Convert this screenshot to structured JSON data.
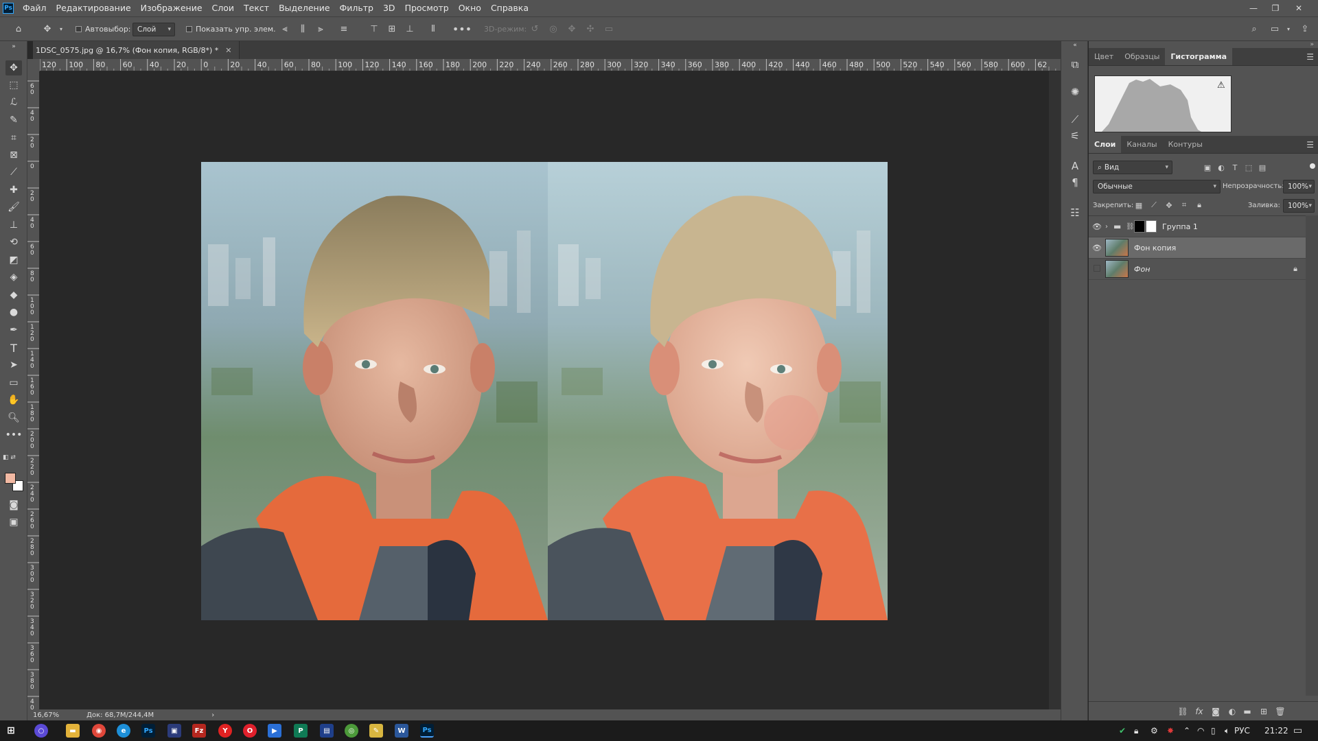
{
  "app": {
    "logo": "Ps"
  },
  "menu": [
    "Файл",
    "Редактирование",
    "Изображение",
    "Слои",
    "Текст",
    "Выделение",
    "Фильтр",
    "3D",
    "Просмотр",
    "Окно",
    "Справка"
  ],
  "options": {
    "auto_select_label": "Автовыбор:",
    "auto_select_value": "Слой",
    "show_transform_label": "Показать упр. элем.",
    "mode_3d_label": "3D-режим:"
  },
  "document": {
    "tab_title": "1DSC_0575.jpg @ 16,7% (Фон копия, RGB/8*) *",
    "zoom": "16,67%",
    "doc_size": "Док: 68,7M/244,4M"
  },
  "rulers": {
    "h_labels": [
      "120",
      "100",
      "80",
      "60",
      "40",
      "20",
      "0",
      "20",
      "40",
      "60",
      "80",
      "100",
      "120",
      "140",
      "160",
      "180",
      "200",
      "220",
      "240",
      "260",
      "280",
      "300",
      "320",
      "340",
      "360",
      "380",
      "400",
      "420",
      "440",
      "460",
      "480",
      "500",
      "520",
      "540",
      "560",
      "580",
      "600",
      "62"
    ],
    "v_labels": [
      "60",
      "40",
      "20",
      "0",
      "20",
      "40",
      "60",
      "80",
      "100",
      "120",
      "140",
      "160",
      "180",
      "200",
      "220",
      "240",
      "260",
      "280",
      "300",
      "320",
      "340",
      "360",
      "380",
      "400"
    ]
  },
  "panels": {
    "top_tabs": [
      "Цвет",
      "Образцы",
      "Гистограмма"
    ],
    "top_active": 2,
    "layer_tabs": [
      "Слои",
      "Каналы",
      "Контуры"
    ],
    "layer_active": 0,
    "filter_kind": "Вид",
    "blend_mode": "Обычные",
    "opacity_label": "Непрозрачность:",
    "opacity_value": "100%",
    "lock_label": "Закрепить:",
    "fill_label": "Заливка:",
    "fill_value": "100%",
    "layers": [
      {
        "name": "Группа 1",
        "visible": true,
        "type": "group"
      },
      {
        "name": "Фон копия",
        "visible": true,
        "type": "pixel",
        "selected": true
      },
      {
        "name": "Фон",
        "visible": false,
        "type": "background",
        "locked": true
      }
    ]
  },
  "colors": {
    "foreground": "#f2b9a3",
    "background": "#ffffff"
  },
  "taskbar": {
    "lang": "РУС",
    "time": "21:22"
  }
}
